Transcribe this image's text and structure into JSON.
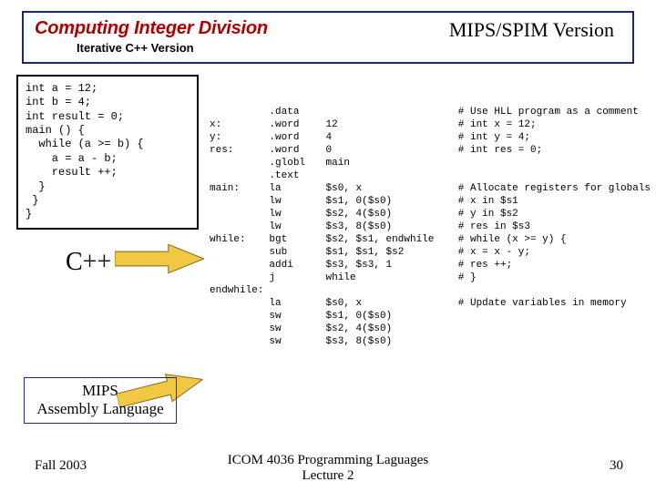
{
  "title": {
    "main": "Computing Integer Division",
    "sub": "Iterative C++ Version",
    "right": "MIPS/SPIM Version"
  },
  "cpp_code": "int a = 12;\nint b = 4;\nint result = 0;\nmain () {\n  while (a >= b) {\n    a = a - b;\n    result ++;\n  }\n }\n}",
  "cpp_label": "C++",
  "mips_label_1": "MIPS",
  "mips_label_2": "Assembly Language",
  "asm": [
    {
      "c1": "",
      "c2": ".data",
      "c3": "",
      "c4": "# Use HLL program as a comment"
    },
    {
      "c1": "x:",
      "c2": ".word",
      "c3": "12",
      "c4": "# int x = 12;"
    },
    {
      "c1": "y:",
      "c2": ".word",
      "c3": "4",
      "c4": "# int y = 4;"
    },
    {
      "c1": "res:",
      "c2": ".word",
      "c3": "0",
      "c4": "# int res = 0;"
    },
    {
      "c1": "",
      "c2": ".globl",
      "c3": "main",
      "c4": ""
    },
    {
      "c1": "",
      "c2": ".text",
      "c3": "",
      "c4": ""
    },
    {
      "c1": "main:",
      "c2": "la",
      "c3": "$s0, x",
      "c4": "# Allocate registers for globals"
    },
    {
      "c1": "",
      "c2": "lw",
      "c3": "$s1, 0($s0)",
      "c4": "#   x in $s1"
    },
    {
      "c1": "",
      "c2": "lw",
      "c3": "$s2, 4($s0)",
      "c4": "#   y in $s2"
    },
    {
      "c1": "",
      "c2": "lw",
      "c3": "$s3, 8($s0)",
      "c4": "#   res in $s3"
    },
    {
      "c1": "while:",
      "c2": "bgt",
      "c3": "$s2, $s1, endwhile",
      "c4": "# while (x >= y) {"
    },
    {
      "c1": "",
      "c2": "sub",
      "c3": "$s1, $s1, $s2",
      "c4": "           #    x = x - y;"
    },
    {
      "c1": "",
      "c2": "addi",
      "c3": "$s3, $s3, 1",
      "c4": "#   res ++;"
    },
    {
      "c1": "",
      "c2": "j",
      "c3": "while",
      "c4": "# }"
    },
    {
      "c1": "endwhile:",
      "c2": "",
      "c3": "",
      "c4": ""
    },
    {
      "c1": "",
      "c2": "la",
      "c3": "$s0, x",
      "c4": "# Update variables in memory"
    },
    {
      "c1": "",
      "c2": "sw",
      "c3": "$s1, 0($s0)",
      "c4": ""
    },
    {
      "c1": "",
      "c2": "sw",
      "c3": "$s2, 4($s0)",
      "c4": ""
    },
    {
      "c1": "",
      "c2": "sw",
      "c3": "$s3, 8($s0)",
      "c4": ""
    }
  ],
  "footer": {
    "left": "Fall 2003",
    "center1": "ICOM 4036 Programming Laguages",
    "center2": "Lecture 2",
    "right": "30"
  },
  "colors": {
    "arrow": "#f2c744",
    "arrow_stroke": "#7a6a20"
  }
}
